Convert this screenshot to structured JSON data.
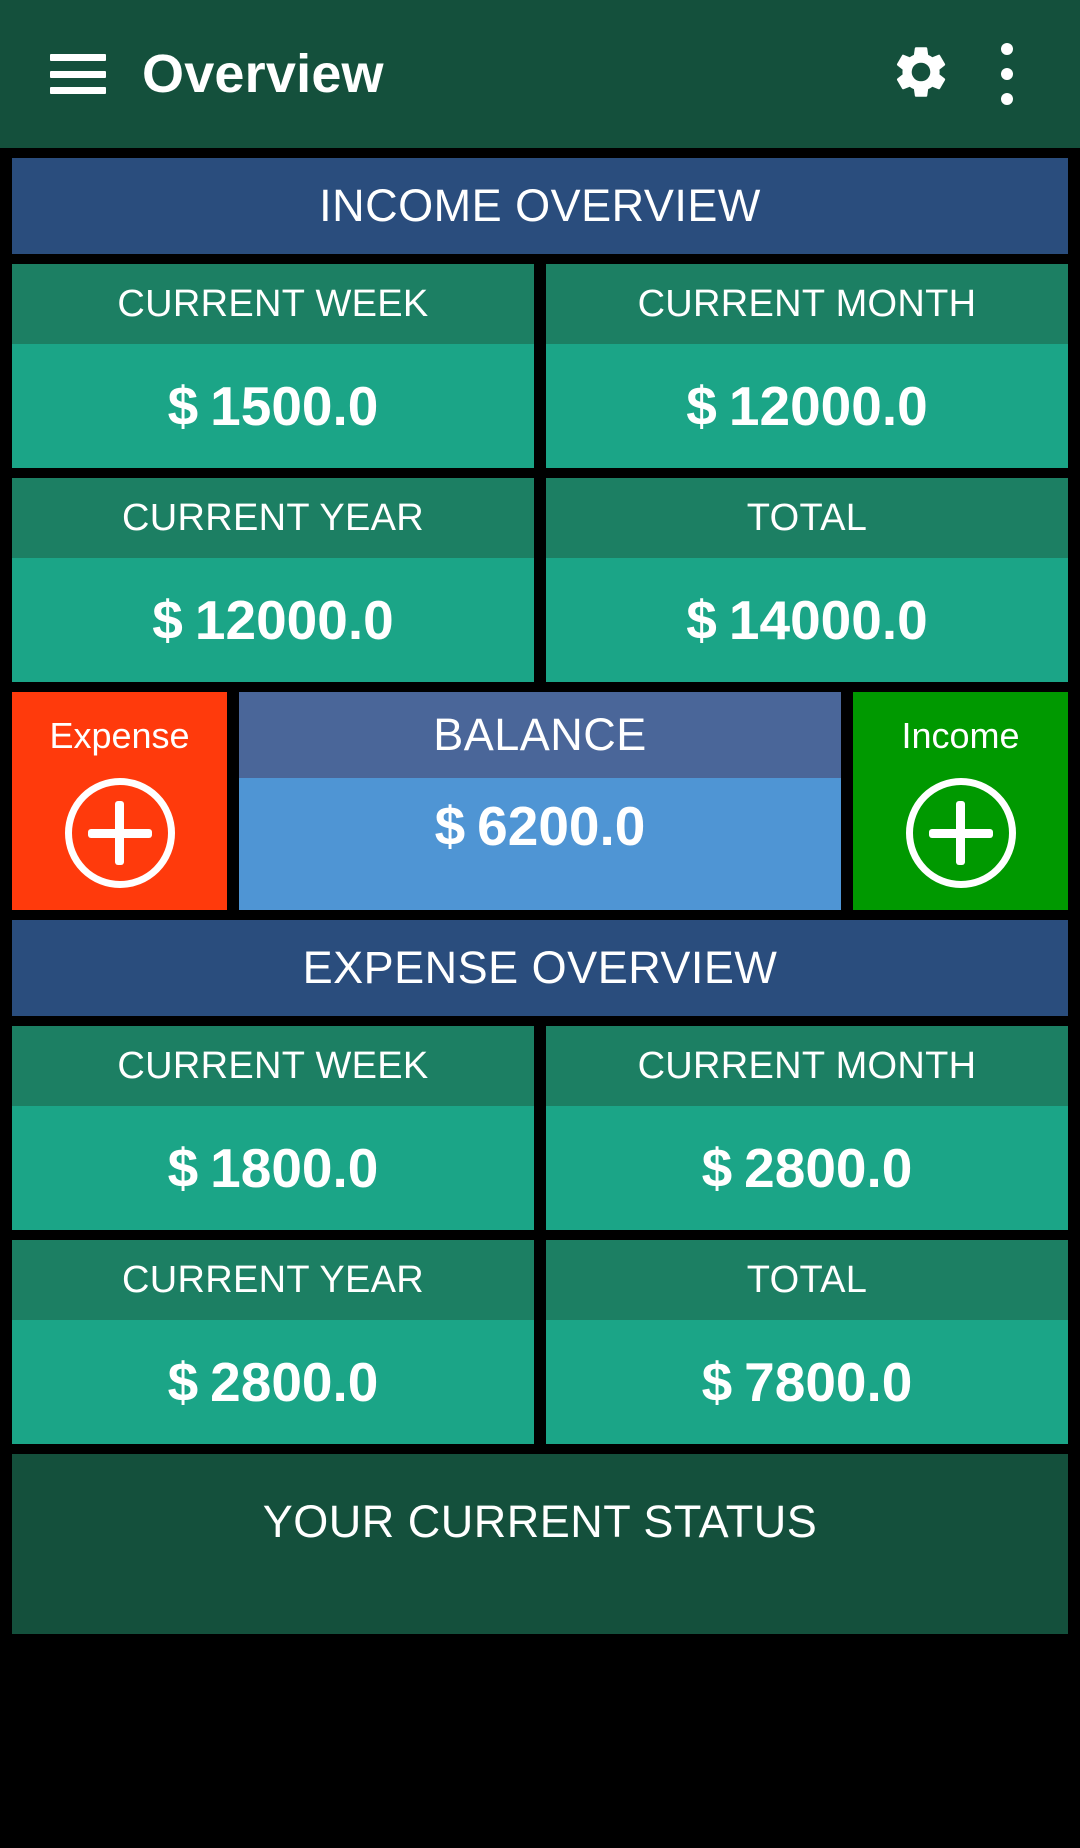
{
  "appbar": {
    "menu_icon": "hamburger-menu-icon",
    "title": "Overview",
    "settings_icon": "gear-icon",
    "more_icon": "kebab-menu-icon"
  },
  "income_section": {
    "banner": "INCOME OVERVIEW",
    "cards": [
      {
        "label": "CURRENT WEEK",
        "currency": "$",
        "value": "1500.0"
      },
      {
        "label": "CURRENT MONTH",
        "currency": "$",
        "value": "12000.0"
      },
      {
        "label": "CURRENT YEAR",
        "currency": "$",
        "value": "12000.0"
      },
      {
        "label": "TOTAL",
        "currency": "$",
        "value": "14000.0"
      }
    ]
  },
  "actions": {
    "expense": {
      "label": "Expense",
      "icon": "plus-circle-icon",
      "color": "#FF3A0C"
    },
    "income": {
      "label": "Income",
      "icon": "plus-circle-icon",
      "color": "#009900"
    },
    "balance": {
      "label": "BALANCE",
      "currency": "$",
      "value": "6200.0",
      "header_color": "#4A6699",
      "body_color": "#4F95D4"
    }
  },
  "expense_section": {
    "banner": "EXPENSE OVERVIEW",
    "cards": [
      {
        "label": "CURRENT WEEK",
        "currency": "$",
        "value": "1800.0"
      },
      {
        "label": "CURRENT MONTH",
        "currency": "$",
        "value": "2800.0"
      },
      {
        "label": "CURRENT YEAR",
        "currency": "$",
        "value": "2800.0"
      },
      {
        "label": "TOTAL",
        "currency": "$",
        "value": "7800.0"
      }
    ]
  },
  "status": {
    "title": "YOUR CURRENT STATUS"
  },
  "theme": {
    "appbar_bg": "#14503C",
    "page_bg": "#000000",
    "banner_bg": "#2A4D7D",
    "card_head_bg": "#1C7F63",
    "card_body_bg": "#1BA587",
    "status_bg": "#14503C"
  }
}
